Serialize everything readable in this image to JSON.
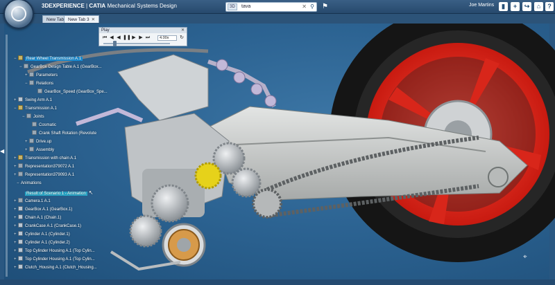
{
  "header": {
    "brand_prefix": "3DEXPERIENCE",
    "brand_app": "CATIA",
    "app_name": "Mechanical Systems Design",
    "search": {
      "scope_label": "3D",
      "value": "tava"
    },
    "user_name": "Joe Martins"
  },
  "tabs": [
    {
      "label": "New Tab 1"
    },
    {
      "label": "New Tab 3"
    }
  ],
  "play_panel": {
    "title": "Play",
    "speed_value": "4.00x"
  },
  "tree": [
    {
      "label": "Rear Wheel Transmission A.1"
    },
    {
      "label": "GearBox Design Table A.1 (GearBox..."
    },
    {
      "label": "Parameters"
    },
    {
      "label": "Relations"
    },
    {
      "label": "GearBox_Speed (GearBox_Spe..."
    },
    {
      "label": "Swing Arm A.1"
    },
    {
      "label": "Transmission A.1"
    },
    {
      "label": "Joints"
    },
    {
      "label": "Cosmatic"
    },
    {
      "label": "Crank Shaft Rotation (Revolute"
    },
    {
      "label": "Drive.up"
    },
    {
      "label": "Assembly"
    },
    {
      "label": "Transmission with chain A.1"
    },
    {
      "label": "Representation379072 A.1"
    },
    {
      "label": "Representation379093 A.1"
    },
    {
      "label": "Animations"
    },
    {
      "label": "Result of Scenario 1 - Animation"
    },
    {
      "label": "Camera.1 A.1"
    },
    {
      "label": "GearBox A.1 (GearBox.1)"
    },
    {
      "label": "Chain A.1 (Chain.1)"
    },
    {
      "label": "CrankCase A.1 (CrankCase.1)"
    },
    {
      "label": "Cylinder A.1 (Cylinder.1)"
    },
    {
      "label": "Cylinder A.1 (Cylinder.2)"
    },
    {
      "label": "Top Cylinder Housing A.1 (Top Cylin..."
    },
    {
      "label": "Top Cylinder Housing A.1 (Top Cylin..."
    },
    {
      "label": "Clutch_Housing A.1 (Clutch_Housing..."
    }
  ],
  "colors": {
    "background": "#2c6392",
    "wheel_rim": "#e8291c",
    "tire": "#1a1a1a",
    "swing_arm": "#c7c9c8",
    "highlight": "#1b8fd6",
    "gear_yellow": "#e6d21a"
  },
  "icons": {
    "compass": "compass-icon",
    "tag": "tag-icon",
    "add": "plus-icon",
    "share": "share-icon",
    "home": "home-icon",
    "help": "help-icon",
    "close_tab": "close-icon"
  }
}
